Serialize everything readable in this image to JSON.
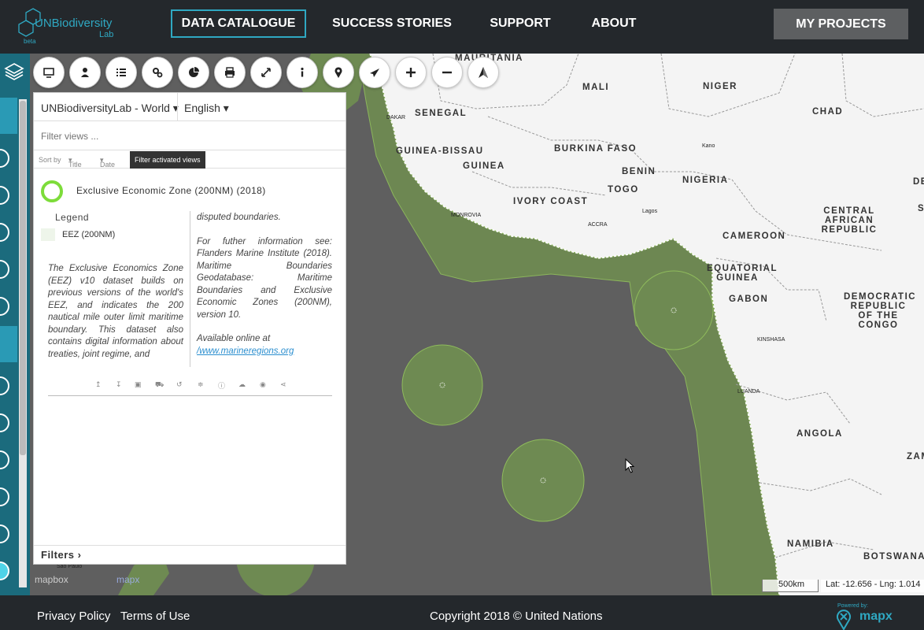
{
  "header": {
    "logo": {
      "text": "UNBiodiversity",
      "sub": "Lab",
      "badge": "beta"
    },
    "nav": [
      "DATA CATALOGUE",
      "SUCCESS STORIES",
      "SUPPORT",
      "ABOUT"
    ],
    "my_projects": "MY PROJECTS"
  },
  "toolbar": {
    "icons": [
      "monitor-icon",
      "user-icon",
      "list-icon",
      "gears-icon",
      "pie-chart-icon",
      "print-icon",
      "expand-icon",
      "info-icon",
      "map-marker-icon",
      "plane-icon",
      "zoom-in-icon",
      "zoom-out-icon",
      "north-arrow-icon"
    ]
  },
  "panel": {
    "project": "UNBiodiversityLab - World",
    "language": "English",
    "filter_placeholder": "Filter views ...",
    "sort": {
      "label": "Sort by",
      "title": "Title",
      "date": "Date",
      "filter_active": "Filter activated views"
    },
    "view": {
      "title": "Exclusive Economic Zone (200NM) (2018)",
      "legend_title": "Legend",
      "legend_item": "EEZ (200NM)",
      "ring_color": "#7ddc3a",
      "description": "The Exclusive Economics Zone (EEZ) v10 dataset builds on previous versions of the world's EEZ, and indicates the 200 nautical mile outer limit maritime boundary. This dataset also contains digital information about treaties, joint regime, and",
      "description2_a": "disputed boundaries.",
      "description2_b": "For futher information see: Flanders Marine Institute (2018). Maritime Boundaries Geodatabase: Maritime Boundaries and Exclusive Economic Zones (200NM), version 10.",
      "description2_c": "Available online at",
      "link": "/www.marineregions.org"
    },
    "filters": "Filters"
  },
  "map": {
    "labels": [
      "MAURITANIA",
      "MALI",
      "NIGER",
      "CHAD",
      "SENEGAL",
      "GUINEA-BISSAU",
      "GUINEA",
      "BURKINA FASO",
      "BENIN",
      "NIGERIA",
      "TOGO",
      "IVORY COAST",
      "CENTRAL AFRICAN REPUBLIC",
      "CAMEROON",
      "EQUATORIAL GUINEA",
      "GABON",
      "DEMOCRATIC REPUBLIC OF THE CONGO",
      "ANGOLA",
      "NAMIBIA",
      "BOTSWANA",
      "ZAM",
      "DE",
      "S"
    ],
    "cities": [
      "DAKAR",
      "Kano",
      "Lagos",
      "ACCRA",
      "KINSHASA",
      "MONROVIA",
      "LUANDA",
      "São Paulo"
    ],
    "land_color": "#f4f4f4",
    "ocean_color": "#5f5f5f",
    "eez_color": "#6e8a52",
    "scale": "500km",
    "coords": "Lat: -12.656 - Lng: 1.014",
    "watermark_mapbox": "mapbox",
    "watermark_mapx": "mapx"
  },
  "footer": {
    "privacy": "Privacy Policy",
    "terms": "Terms of Use",
    "copyright": "Copyright 2018 © United Nations",
    "powered": "Powered by:",
    "brand": "mapx"
  }
}
